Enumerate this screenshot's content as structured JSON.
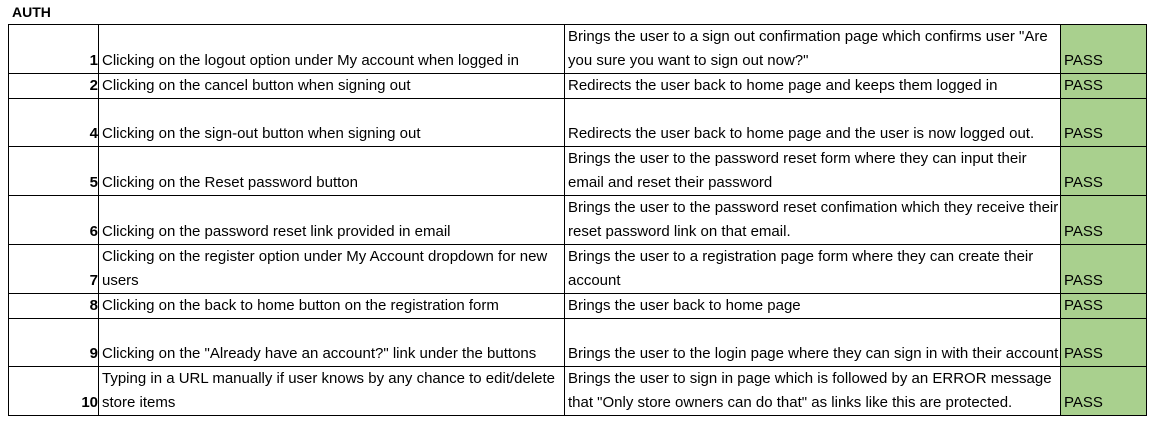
{
  "sheet": {
    "title": "AUTH",
    "rows": [
      {
        "id": "1",
        "action": "Clicking on the logout option under My account when logged in",
        "expected": "Brings the user to a sign out confirmation page which confirms user \"Are you sure you want to sign out now?\"",
        "result": "PASS"
      },
      {
        "id": "2",
        "action": "Clicking on the cancel button when signing out",
        "expected": "Redirects the user back to home page and keeps them logged in",
        "result": "PASS"
      },
      {
        "id": "4",
        "action": "Clicking on the sign-out button when signing out",
        "expected": "Redirects the user back to home page and the user is now logged out.",
        "result": "PASS"
      },
      {
        "id": "5",
        "action": "Clicking on the Reset password button",
        "expected": "Brings the user to the password reset form where they can input their email and reset their password",
        "result": "PASS"
      },
      {
        "id": "6",
        "action": "Clicking on the password reset link provided in email",
        "expected": "Brings the user to the password reset confimation which they receive their reset password link on that email.",
        "result": "PASS"
      },
      {
        "id": "7",
        "action": "Clicking on the register option under My Account dropdown for new users",
        "expected": "Brings the user to a registration page form where they can create their account",
        "result": "PASS"
      },
      {
        "id": "8",
        "action": "Clicking on the back to home button on the registration form",
        "expected": "Brings the user back to home page",
        "result": "PASS"
      },
      {
        "id": "9",
        "action": "Clicking on the \"Already have an account?\" link under the buttons",
        "expected": "Brings the user to the login page where they can sign in with their account",
        "result": "PASS"
      },
      {
        "id": "10",
        "action": "Typing in a URL manually if user knows by any chance to edit/delete store items",
        "expected": "Brings the user to sign in page which is followed by an ERROR message that \"Only store owners can do that\" as links like this are protected.",
        "result": "PASS"
      }
    ]
  },
  "colors": {
    "pass_fill": "#a9d08e"
  }
}
